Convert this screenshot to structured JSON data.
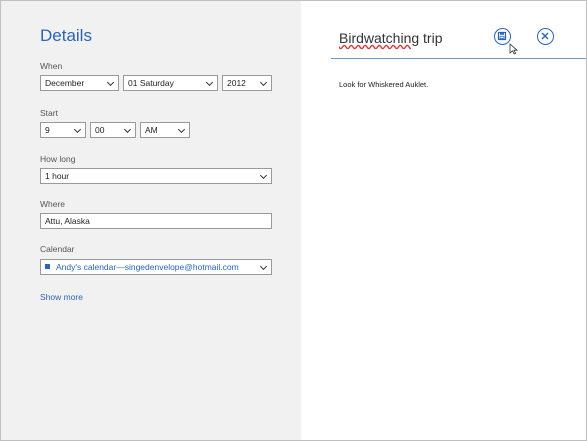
{
  "details": {
    "title": "Details",
    "when_label": "When",
    "month": "December",
    "day": "01 Saturday",
    "year": "2012",
    "start_label": "Start",
    "hour": "9",
    "minute": "00",
    "ampm": "AM",
    "how_long_label": "How long",
    "duration": "1 hour",
    "where_label": "Where",
    "where_value": "Attu, Alaska",
    "calendar_label": "Calendar",
    "calendar_value": "Andy's calendar—singedenvelope@hotmail.com",
    "show_more": "Show more"
  },
  "event": {
    "title_word1": "Birdwatching",
    "title_word2": "trip",
    "notes": "Look for Whiskered Auklet."
  },
  "icons": {
    "save": "save-icon",
    "close": "close-icon"
  },
  "colors": {
    "accent": "#2a64b6",
    "left_panel_bg": "#f1f1f1",
    "spellcheck": "#d83a3a"
  }
}
